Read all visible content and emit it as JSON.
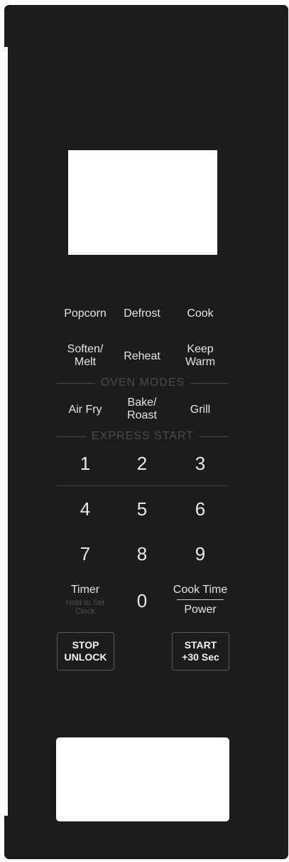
{
  "presets": {
    "popcorn": "Popcorn",
    "defrost": "Defrost",
    "cook": "Cook",
    "soften_melt": [
      "Soften/",
      "Melt"
    ],
    "reheat": "Reheat",
    "keep_warm": [
      "Keep",
      "Warm"
    ]
  },
  "oven_modes": {
    "label": "OVEN MODES",
    "air_fry": "Air Fry",
    "bake_roast": [
      "Bake/",
      "Roast"
    ],
    "grill": "Grill"
  },
  "express_start": {
    "label": "EXPRESS START"
  },
  "keypad": {
    "digits": [
      "1",
      "2",
      "3",
      "4",
      "5",
      "6",
      "7",
      "8",
      "9",
      "0"
    ]
  },
  "timer": {
    "label": "Timer",
    "hint": [
      "Hold to Set",
      "Clock"
    ]
  },
  "cook_time_power": {
    "cook_time": "Cook Time",
    "power": "Power"
  },
  "stop_button": [
    "STOP",
    "UNLOCK"
  ],
  "start_button": [
    "START",
    "+30 Sec"
  ],
  "colors": {
    "panel": "#1d1b1c",
    "text": "#e6e6e6",
    "muted_label": "#4c4a4b",
    "window": "#ffffff"
  }
}
